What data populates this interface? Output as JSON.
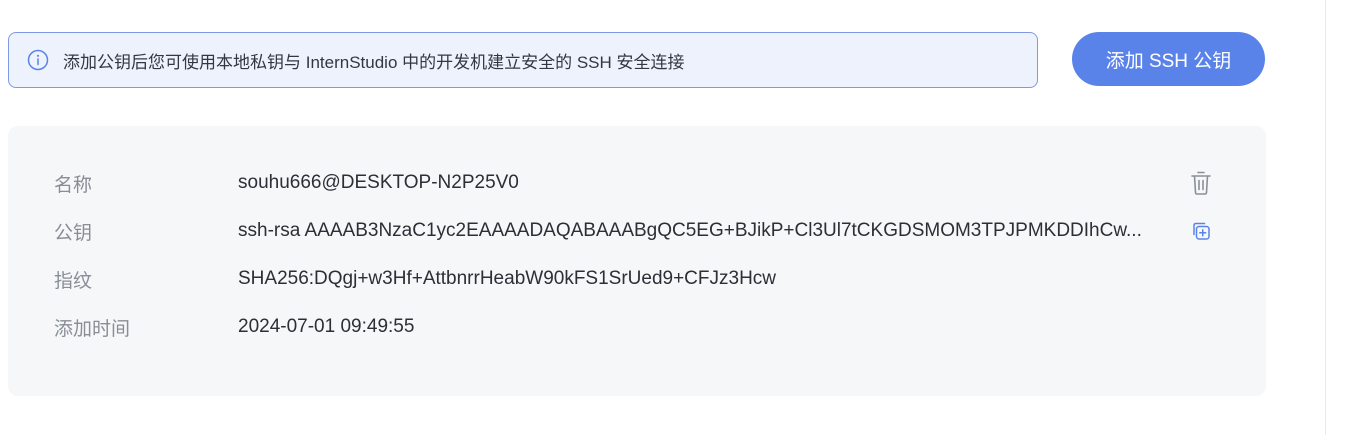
{
  "notice": {
    "icon": "info-icon",
    "text": "添加公钥后您可使用本地私钥与 InternStudio 中的开发机建立安全的 SSH 安全连接"
  },
  "actions": {
    "add_ssh_key_label": "添加 SSH 公钥"
  },
  "ssh_key": {
    "name_label": "名称",
    "name_value": "souhu666@DESKTOP-N2P25V0",
    "key_label": "公钥",
    "key_value": "ssh-rsa AAAAB3NzaC1yc2EAAAADAQABAAABgQC5EG+BJikP+Cl3Ul7tCKGDSMOM3TPJPMKDDIhCw...",
    "fingerprint_label": "指纹",
    "fingerprint_value": "SHA256:DQgj+w3Hf+AttbnrrHeabW90kFS1SrUed9+CFJz3Hcw",
    "added_time_label": "添加时间",
    "added_time_value": "2024-07-01 09:49:55",
    "delete_icon": "trash-icon",
    "copy_icon": "copy-icon"
  },
  "colors": {
    "accent": "#5a83ea",
    "notice_bg": "#eef2fc",
    "notice_border": "#7f9ae0",
    "card_bg": "#f6f7f9",
    "label_text": "#888d96",
    "value_text": "#2b2f36"
  }
}
